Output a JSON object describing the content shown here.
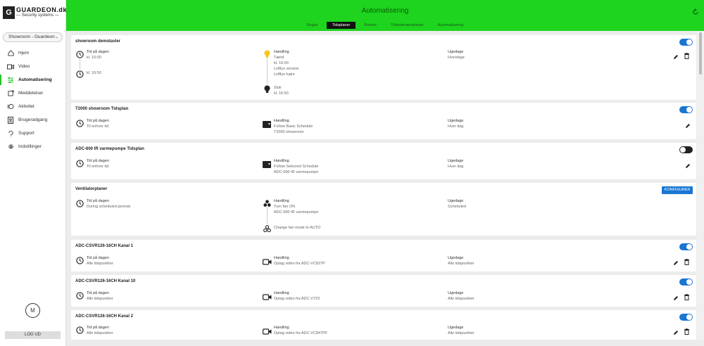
{
  "brand": {
    "mark": "G",
    "name": "GUARDEON.dk",
    "sub": "— Security systems —"
  },
  "location": {
    "label": "Showroom - Guardeon"
  },
  "nav": [
    {
      "label": "Hjem",
      "icon": "home-icon"
    },
    {
      "label": "Video",
      "icon": "video-icon"
    },
    {
      "label": "Automatisering",
      "icon": "automation-icon",
      "active": true
    },
    {
      "label": "Meddelelser",
      "icon": "message-icon"
    },
    {
      "label": "Aktivitet",
      "icon": "activity-icon"
    },
    {
      "label": "Brugeradgang",
      "icon": "user-access-icon"
    },
    {
      "label": "Support",
      "icon": "support-icon"
    },
    {
      "label": "Indstillinger",
      "icon": "settings-icon"
    }
  ],
  "user": {
    "initial": "M",
    "logout": "LOG UD"
  },
  "header": {
    "title": "Automatisering"
  },
  "tabs": [
    {
      "label": "Regler"
    },
    {
      "label": "Tidsplaner",
      "selected": true
    },
    {
      "label": "Rutiner"
    },
    {
      "label": "Tilstedeværsplaner"
    },
    {
      "label": "Automatisering"
    }
  ],
  "colors": {
    "accent": "#1976d2",
    "header": "#1ed41e"
  },
  "cards": [
    {
      "title": "showroom demotavler",
      "toggle": "on",
      "time_rows": [
        {
          "label": "Tid på dagen",
          "value": "kl. 16:00"
        },
        {
          "label": "",
          "value": "kl. 16:50"
        }
      ],
      "actions": [
        {
          "icon": "bulb-on-icon",
          "label": "Handling",
          "lines": [
            "Tænd",
            "kl. 16:00",
            "Loftlys venstre",
            "Loftlys højre"
          ]
        },
        {
          "icon": "bulb-off-icon",
          "label": "Sluk",
          "lines": [
            "kl. 16:50"
          ]
        }
      ],
      "weekday": {
        "label": "Ugedage",
        "value": "Hverdage"
      },
      "edit": true,
      "delete": true
    },
    {
      "title": "T2000 showroom Tidsplan",
      "toggle": "on",
      "time": {
        "label": "Tid på dagen",
        "value": "Til enhver tid"
      },
      "action": {
        "icon": "thermostat-icon",
        "label": "Handling",
        "lines": [
          "Follow Basic Schedule",
          "T2000 showroom"
        ]
      },
      "weekday": {
        "label": "Ugedage",
        "value": "Hver dag"
      },
      "edit": true,
      "delete": false
    },
    {
      "title": "ADC-600 IR varmepumpe Tidsplan",
      "toggle": "off",
      "time": {
        "label": "Tid på dagen",
        "value": "Til enhver tid"
      },
      "action": {
        "icon": "thermostat-icon",
        "label": "Handling",
        "lines": [
          "Follow Selected Schedule",
          "ADC-600 IR varmepumpe"
        ]
      },
      "weekday": {
        "label": "Ugedage",
        "value": "Hver dag"
      },
      "edit": true,
      "delete": false
    },
    {
      "title": "Ventilatorplaner",
      "button": "KONFIGURER",
      "time": {
        "label": "Tid på dagen",
        "value": "During scheduled periods"
      },
      "action": {
        "icon": "fan-icon",
        "label": "Handling",
        "lines": [
          "Turn fan ON",
          "ADC-600 IR varmepumpe"
        ]
      },
      "action2": {
        "icon": "fan-auto-icon",
        "label": "Change fan mode to AUTO"
      },
      "weekday": {
        "label": "Ugedage",
        "value": "Scheduled"
      }
    },
    {
      "title": "ADC-CSVR126-16CH Kanal 1",
      "toggle": "on",
      "time": {
        "label": "Tid på dagen",
        "value": "Alle tidspunkter"
      },
      "action": {
        "icon": "camera-icon",
        "label": "Handling",
        "lines": [
          "Optag video fra ADC-VC827P"
        ]
      },
      "weekday": {
        "label": "Ugedage",
        "value": "Alle tidspunkter"
      },
      "edit": true,
      "delete": true
    },
    {
      "title": "ADC-CSVR126-16CH Kanal 10",
      "toggle": "on",
      "time": {
        "label": "Tid på dagen",
        "value": "Alle tidspunkter"
      },
      "action": {
        "icon": "camera-icon",
        "label": "Handling",
        "lines": [
          "Optag video fra ADC-V723"
        ]
      },
      "weekday": {
        "label": "Ugedage",
        "value": "Alle tidspunkter"
      },
      "edit": true,
      "delete": true
    },
    {
      "title": "ADC-CSVR126-16CH Kanal 2",
      "toggle": "on",
      "time": {
        "label": "Tid på dagen",
        "value": "Alle tidspunkter"
      },
      "action": {
        "icon": "camera-icon",
        "label": "Handling",
        "lines": [
          "Optag video fra ADC-VC847PF"
        ]
      },
      "weekday": {
        "label": "Ugedage",
        "value": "Alle tidspunkter"
      },
      "edit": true,
      "delete": true
    }
  ]
}
